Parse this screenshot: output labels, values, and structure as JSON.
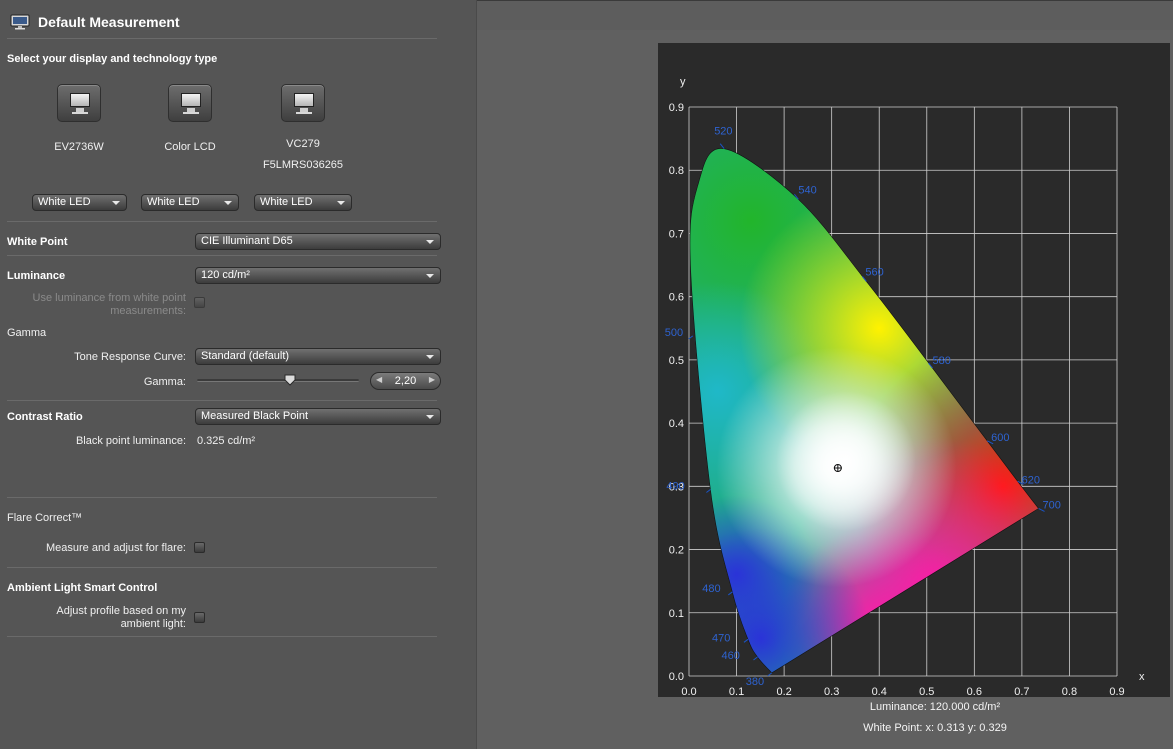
{
  "window": {
    "title": "Default Measurement",
    "title_icon": "monitor-icon"
  },
  "display_section": {
    "heading": "Select your display and technology type",
    "devices": [
      {
        "name": "EV2736W",
        "serial": "",
        "technology": "White LED"
      },
      {
        "name": "Color LCD",
        "serial": "",
        "technology": "White LED"
      },
      {
        "name": "VC279",
        "serial": "F5LMRS036265",
        "technology": "White LED"
      }
    ]
  },
  "white_point": {
    "label": "White Point",
    "value": "CIE Illuminant D65"
  },
  "luminance": {
    "label": "Luminance",
    "value": "120 cd/m²",
    "use_wp_label": "Use luminance from white point measurements:",
    "use_wp_checked": false
  },
  "gamma": {
    "heading": "Gamma",
    "tone_label": "Tone Response Curve:",
    "tone_value": "Standard (default)",
    "gamma_label": "Gamma:",
    "gamma_value": "2,20",
    "gamma_slider_fraction": 0.6
  },
  "contrast": {
    "label": "Contrast Ratio",
    "value": "Measured Black Point",
    "black_label": "Black point luminance:",
    "black_value": "0.325 cd/m²"
  },
  "flare": {
    "heading": "Flare Correct™",
    "measure_label": "Measure and adjust for flare:",
    "checked": false
  },
  "ambient": {
    "heading": "Ambient Light Smart Control",
    "adjust_label": "Adjust profile based on my ambient light:",
    "checked": false
  },
  "chart_data": {
    "type": "scatter",
    "title": "",
    "xlabel": "x",
    "ylabel": "y",
    "xlim": [
      0,
      0.9
    ],
    "ylim": [
      0,
      0.9
    ],
    "grid": true,
    "x_ticks": [
      "0.0",
      "0.1",
      "0.2",
      "0.3",
      "0.4",
      "0.5",
      "0.6",
      "0.7",
      "0.8",
      "0.9"
    ],
    "y_ticks": [
      "0.0",
      "0.1",
      "0.2",
      "0.3",
      "0.4",
      "0.5",
      "0.6",
      "0.7",
      "0.8",
      "0.9"
    ],
    "spectral_locus": [
      {
        "x": 0.174,
        "y": 0.005,
        "label": "380"
      },
      {
        "x": 0.144,
        "y": 0.03,
        "label": "460"
      },
      {
        "x": 0.124,
        "y": 0.058,
        "label": "470"
      },
      {
        "x": 0.091,
        "y": 0.133,
        "label": "480"
      },
      {
        "x": 0.045,
        "y": 0.295,
        "label": "490"
      },
      {
        "x": 0.008,
        "y": 0.538,
        "label": "500"
      },
      {
        "x": 0.074,
        "y": 0.834,
        "label": "520"
      },
      {
        "x": 0.23,
        "y": 0.754,
        "label": "540"
      },
      {
        "x": 0.373,
        "y": 0.624,
        "label": "560"
      },
      {
        "x": 0.512,
        "y": 0.487,
        "label": "580"
      },
      {
        "x": 0.627,
        "y": 0.372,
        "label": "600"
      },
      {
        "x": 0.691,
        "y": 0.308,
        "label": "620"
      },
      {
        "x": 0.735,
        "y": 0.265,
        "label": "700"
      }
    ],
    "white_point": {
      "x": 0.313,
      "y": 0.329
    }
  },
  "captions": {
    "luminance": "Luminance: 120.000 cd/m²",
    "white_point": "White Point: x: 0.313  y: 0.329"
  }
}
